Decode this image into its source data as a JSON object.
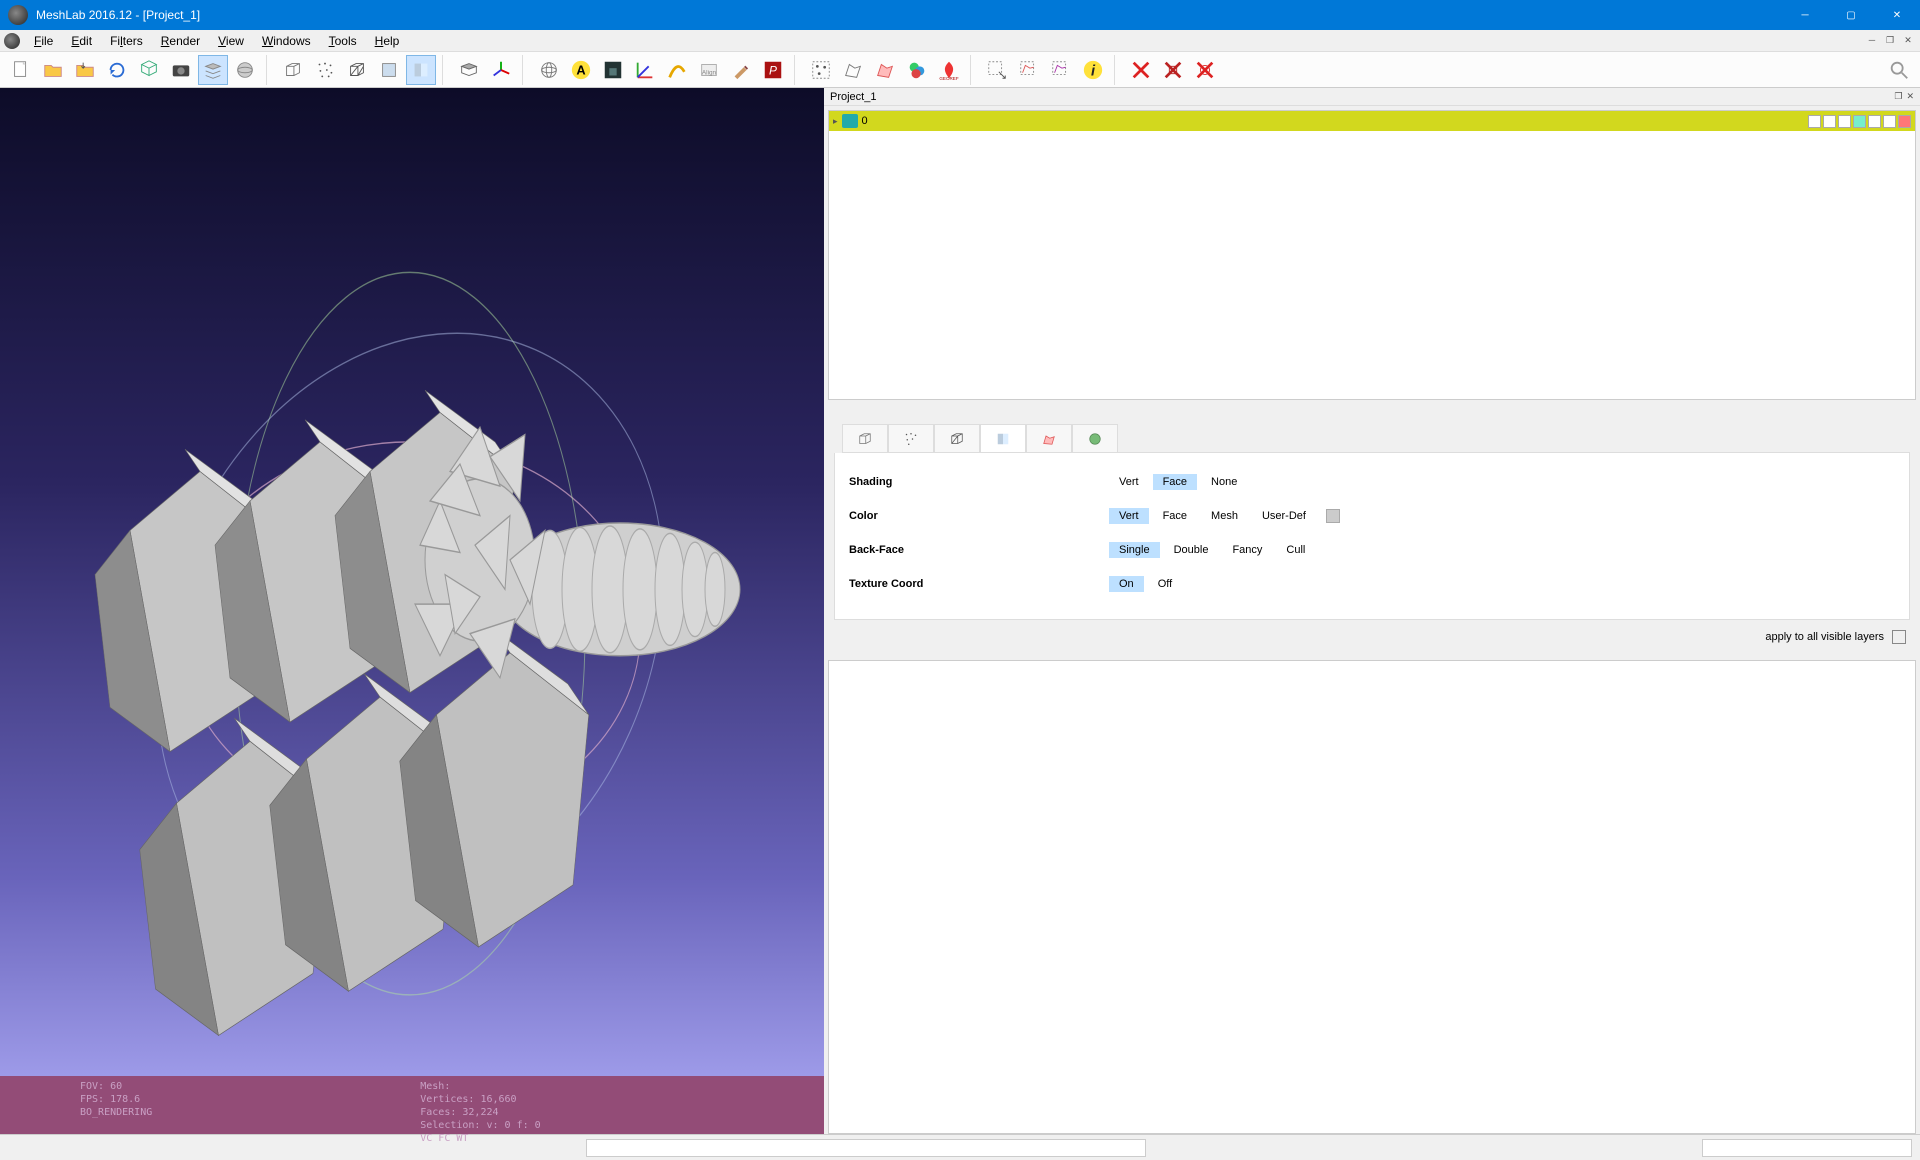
{
  "app": {
    "title": "MeshLab 2016.12 - [Project_1]"
  },
  "menu": {
    "items": [
      "File",
      "Edit",
      "Filters",
      "Render",
      "View",
      "Windows",
      "Tools",
      "Help"
    ]
  },
  "toolbar": {
    "icons": [
      "new-project",
      "open-project",
      "open-recent",
      "reload",
      "export",
      "snapshot",
      "layers",
      "layer-side",
      "bbox",
      "points",
      "wireframe",
      "flat",
      "smooth",
      "sep",
      "texture",
      "axes",
      "sep",
      "sphere",
      "yellow-a",
      "dark-cam",
      "gizmo",
      "select-tool",
      "brush",
      "red-p",
      "sep",
      "sel-vert",
      "sel-face",
      "sel-all",
      "colorize",
      "georef",
      "sep",
      "sel-a",
      "sel-b",
      "sel-c",
      "info",
      "sep",
      "del-x",
      "del-y",
      "del-z"
    ]
  },
  "project_panel": {
    "title": "Project_1",
    "layer": {
      "name": "0"
    }
  },
  "shading_panel": {
    "shading": {
      "label": "Shading",
      "options": [
        "Vert",
        "Face",
        "None"
      ],
      "selected": "Face"
    },
    "color": {
      "label": "Color",
      "options": [
        "Vert",
        "Face",
        "Mesh",
        "User-Def"
      ],
      "selected": "Vert"
    },
    "backface": {
      "label": "Back-Face",
      "options": [
        "Single",
        "Double",
        "Fancy",
        "Cull"
      ],
      "selected": "Single"
    },
    "texcoord": {
      "label": "Texture Coord",
      "options": [
        "On",
        "Off"
      ],
      "selected": "On"
    },
    "apply_label": "apply to all visible layers"
  },
  "viewport_status": {
    "left": [
      "FOV: 60",
      "FPS: 178.6",
      "BO_RENDERING"
    ],
    "right": [
      "Mesh:",
      "Vertices: 16,660",
      "Faces: 32,224",
      "Selection: v: 0 f: 0",
      "VC FC WT"
    ]
  }
}
